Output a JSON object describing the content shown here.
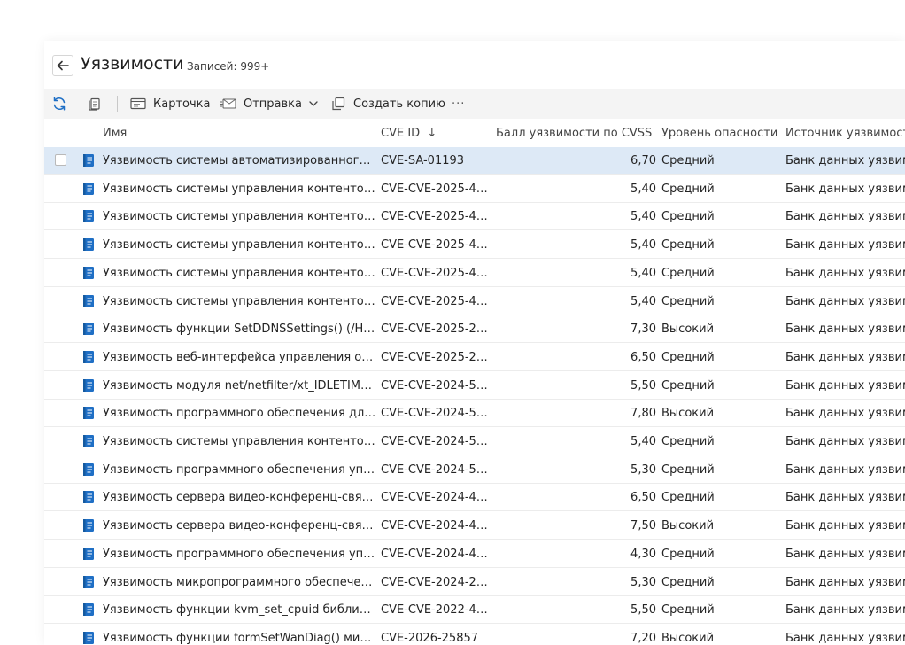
{
  "header": {
    "title": "Уязвимости",
    "record_count": "Записей: 999+"
  },
  "toolbar": {
    "refresh_icon": "refresh-icon",
    "copy_icon": "copy-icon",
    "card_label": "Карточка",
    "send_label": "Отправка",
    "create_copy_label": "Создать копию",
    "more_label": "···"
  },
  "columns": {
    "name": "Имя",
    "cve_id": "CVE ID",
    "cve_id_sort": "↓",
    "cvss": "Балл уязвимости по CVSS",
    "severity": "Уровень опасности",
    "source": "Источник уязвимости"
  },
  "colors": {
    "accent": "#1f6fc5",
    "selected_row": "#dde9f6",
    "toolbar_bg": "#f4f4f4"
  },
  "rows": [
    {
      "name": "Уязвимость системы автоматизированного пр...",
      "cve_id": "CVE-SA-01193",
      "cvss": "6,70",
      "severity": "Средний",
      "source": "Банк данных уязвимостей"
    },
    {
      "name": "Уязвимость системы управления контентом и...",
      "cve_id": "CVE-CVE-2025-47...",
      "cvss": "5,40",
      "severity": "Средний",
      "source": "Банк данных уязвимостей"
    },
    {
      "name": "Уязвимость системы управления контентом и...",
      "cve_id": "CVE-CVE-2025-47...",
      "cvss": "5,40",
      "severity": "Средний",
      "source": "Банк данных уязвимостей"
    },
    {
      "name": "Уязвимость системы управления контентом и...",
      "cve_id": "CVE-CVE-2025-47...",
      "cvss": "5,40",
      "severity": "Средний",
      "source": "Банк данных уязвимостей"
    },
    {
      "name": "Уязвимость системы управления контентом и...",
      "cve_id": "CVE-CVE-2025-47...",
      "cvss": "5,40",
      "severity": "Средний",
      "source": "Банк данных уязвимостей"
    },
    {
      "name": "Уязвимость системы управления контентом и...",
      "cve_id": "CVE-CVE-2025-46...",
      "cvss": "5,40",
      "severity": "Средний",
      "source": "Банк данных уязвимостей"
    },
    {
      "name": "Уязвимость функции SetDDNSSettings() (/HNA...",
      "cve_id": "CVE-CVE-2025-23...",
      "cvss": "7,30",
      "severity": "Высокий",
      "source": "Банк данных уязвимостей"
    },
    {
      "name": "Уязвимость веб-интерфейса управления опер...",
      "cve_id": "CVE-CVE-2025-20...",
      "cvss": "6,50",
      "severity": "Средний",
      "source": "Банк данных уязвимостей"
    },
    {
      "name": "Уязвимость модуля net/netfilter/xt_IDLETIMER....",
      "cve_id": "CVE-CVE-2024-54...",
      "cvss": "5,50",
      "severity": "Средний",
      "source": "Банк данных уязвимостей"
    },
    {
      "name": "Уязвимость программного обеспечения для 3...",
      "cve_id": "CVE-CVE-2024-52...",
      "cvss": "7,80",
      "severity": "Высокий",
      "source": "Банк данных уязвимостей"
    },
    {
      "name": "Уязвимость системы управления контентом и...",
      "cve_id": "CVE-CVE-2024-52...",
      "cvss": "5,40",
      "severity": "Средний",
      "source": "Банк данных уязвимостей"
    },
    {
      "name": "Уязвимость программного обеспечения упра...",
      "cve_id": "CVE-CVE-2024-52...",
      "cvss": "5,30",
      "severity": "Средний",
      "source": "Банк данных уязвимостей"
    },
    {
      "name": "Уязвимость сервера видео-конференц-связи ...",
      "cve_id": "CVE-CVE-2024-48...",
      "cvss": "6,50",
      "severity": "Средний",
      "source": "Банк данных уязвимостей"
    },
    {
      "name": "Уязвимость сервера видео-конференц-связи ...",
      "cve_id": "CVE-CVE-2024-48...",
      "cvss": "7,50",
      "severity": "Высокий",
      "source": "Банк данных уязвимостей"
    },
    {
      "name": "Уязвимость программного обеспечения упра...",
      "cve_id": "CVE-CVE-2024-47...",
      "cvss": "4,30",
      "severity": "Средний",
      "source": "Банк данных уязвимостей"
    },
    {
      "name": "Уязвимость микропрограммного обеспечени...",
      "cve_id": "CVE-CVE-2024-21...",
      "cvss": "5,30",
      "severity": "Средний",
      "source": "Банк данных уязвимостей"
    },
    {
      "name": "Уязвимость функции kvm_set_cpuid библиоте...",
      "cve_id": "CVE-CVE-2022-48...",
      "cvss": "5,50",
      "severity": "Средний",
      "source": "Банк данных уязвимостей"
    },
    {
      "name": "Уязвимость функции formSetWanDiag() микро...",
      "cve_id": "CVE-2026-25857",
      "cvss": "7,20",
      "severity": "Высокий",
      "source": "Банк данных уязвимостей"
    }
  ]
}
